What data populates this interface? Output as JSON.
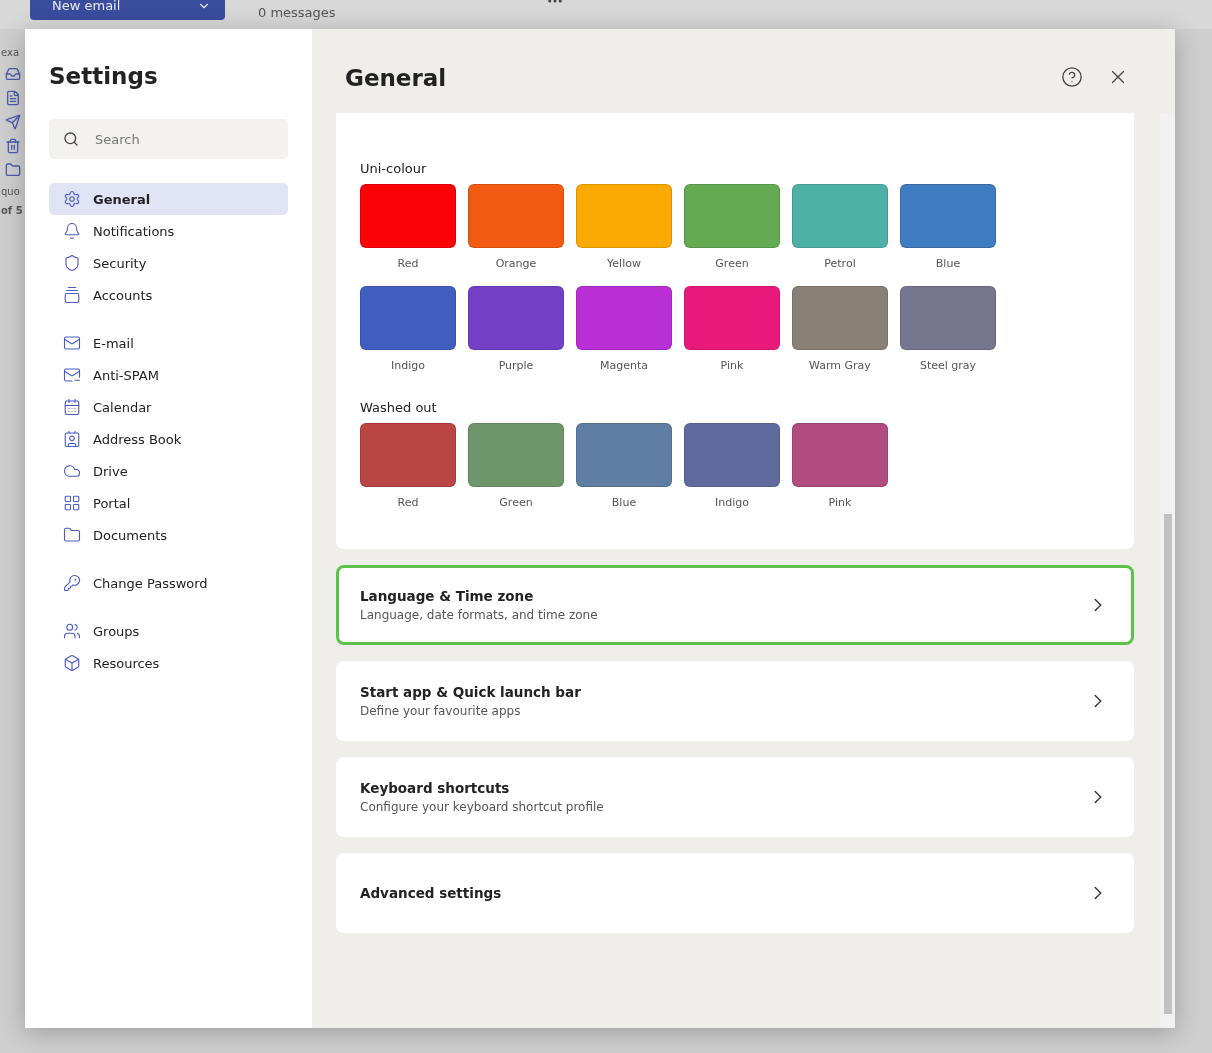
{
  "background": {
    "new_email_button": "New email",
    "message_count": "0 messages",
    "side_texts": [
      "exa",
      "quo",
      "of 5"
    ]
  },
  "settings": {
    "title": "Settings",
    "search": {
      "placeholder": "Search"
    },
    "sidebar": {
      "groups": [
        {
          "items": [
            {
              "label": "General",
              "selected": true
            },
            {
              "label": "Notifications",
              "selected": false
            },
            {
              "label": "Security",
              "selected": false
            },
            {
              "label": "Accounts",
              "selected": false
            }
          ]
        },
        {
          "items": [
            {
              "label": "E-mail",
              "selected": false
            },
            {
              "label": "Anti-SPAM",
              "selected": false
            },
            {
              "label": "Calendar",
              "selected": false
            },
            {
              "label": "Address Book",
              "selected": false
            },
            {
              "label": "Drive",
              "selected": false
            },
            {
              "label": "Portal",
              "selected": false
            },
            {
              "label": "Documents",
              "selected": false
            }
          ]
        },
        {
          "items": [
            {
              "label": "Change Password",
              "selected": false
            }
          ]
        },
        {
          "items": [
            {
              "label": "Groups",
              "selected": false
            },
            {
              "label": "Resources",
              "selected": false
            }
          ]
        }
      ]
    },
    "page_title": "General",
    "color_groups": [
      {
        "title": "Uni-colour",
        "swatches": [
          {
            "label": "Red",
            "color": "#fb0207"
          },
          {
            "label": "Orange",
            "color": "#f25b12"
          },
          {
            "label": "Yellow",
            "color": "#fca902"
          },
          {
            "label": "Green",
            "color": "#63aa53"
          },
          {
            "label": "Petrol",
            "color": "#4db1a7"
          },
          {
            "label": "Blue",
            "color": "#3f7cc1"
          },
          {
            "label": "Indigo",
            "color": "#3f5ebf"
          },
          {
            "label": "Purple",
            "color": "#723fc6"
          },
          {
            "label": "Magenta",
            "color": "#b92fd5"
          },
          {
            "label": "Pink",
            "color": "#e9197c"
          },
          {
            "label": "Warm Gray",
            "color": "#888275"
          },
          {
            "label": "Steel gray",
            "color": "#76778f"
          }
        ]
      },
      {
        "title": "Washed out",
        "swatches": [
          {
            "label": "Red",
            "color": "#b94545"
          },
          {
            "label": "Green",
            "color": "#6f966a"
          },
          {
            "label": "Blue",
            "color": "#607ea4"
          },
          {
            "label": "Indigo",
            "color": "#616a9e"
          },
          {
            "label": "Pink",
            "color": "#b04c7f"
          }
        ]
      }
    ],
    "sections": [
      {
        "title": "Language & Time zone",
        "subtitle": "Language, date formats, and time zone",
        "highlighted": true
      },
      {
        "title": "Start app & Quick launch bar",
        "subtitle": "Define your favourite apps",
        "highlighted": false
      },
      {
        "title": "Keyboard shortcuts",
        "subtitle": "Configure your keyboard shortcut profile",
        "highlighted": false
      },
      {
        "title": "Advanced settings",
        "highlighted": false
      }
    ]
  }
}
